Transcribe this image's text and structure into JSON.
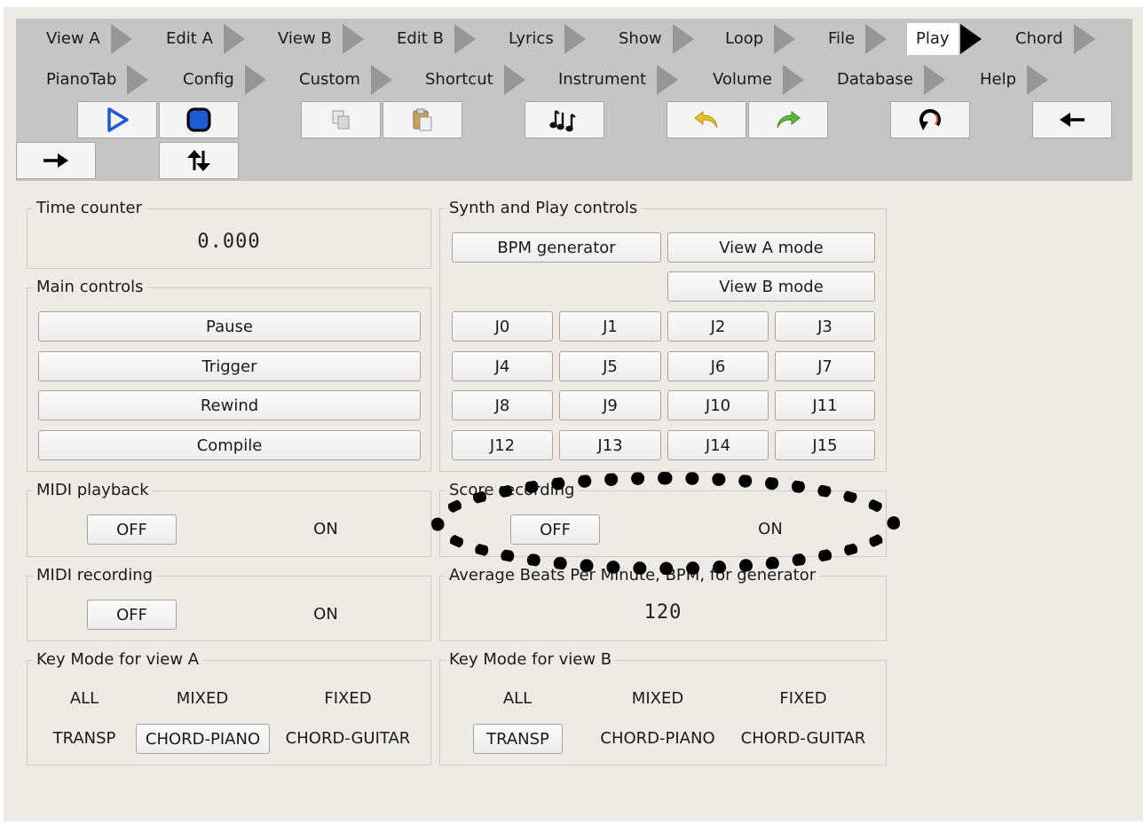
{
  "menu": {
    "row1": [
      {
        "label": "View A"
      },
      {
        "label": "Edit A"
      },
      {
        "label": "View B"
      },
      {
        "label": "Edit B"
      },
      {
        "label": "Lyrics"
      },
      {
        "label": "Show"
      },
      {
        "label": "Loop"
      },
      {
        "label": "File"
      },
      {
        "label": "Play",
        "active": true
      },
      {
        "label": "Chord"
      }
    ],
    "row2": [
      {
        "label": "PianoTab"
      },
      {
        "label": "Config"
      },
      {
        "label": "Custom"
      },
      {
        "label": "Shortcut"
      },
      {
        "label": "Instrument"
      },
      {
        "label": "Volume"
      },
      {
        "label": "Database"
      },
      {
        "label": "Help"
      }
    ]
  },
  "toolbar": {
    "icons": [
      "play-icon",
      "stop-icon",
      "copy-icon",
      "paste-icon",
      "music-notes-icon",
      "undo-icon",
      "redo-icon",
      "refresh-icon",
      "arrow-left-icon",
      "arrow-right-icon",
      "swap-vertical-icon"
    ]
  },
  "time_counter": {
    "title": "Time counter",
    "value": "0.000"
  },
  "main_controls": {
    "title": "Main controls",
    "pause": "Pause",
    "trigger": "Trigger",
    "rewind": "Rewind",
    "compile": "Compile"
  },
  "synth": {
    "title": "Synth and Play controls",
    "bpm_generator": "BPM generator",
    "view_a_mode": "View A mode",
    "view_b_mode": "View B mode",
    "jumps": [
      "J0",
      "J1",
      "J2",
      "J3",
      "J4",
      "J5",
      "J6",
      "J7",
      "J8",
      "J9",
      "J10",
      "J11",
      "J12",
      "J13",
      "J14",
      "J15"
    ]
  },
  "midi_playback": {
    "title": "MIDI playback",
    "off": "OFF",
    "on": "ON",
    "selected": "OFF"
  },
  "score_recording": {
    "title": "Score recording",
    "off": "OFF",
    "on": "ON",
    "selected": "OFF"
  },
  "midi_recording": {
    "title": "MIDI recording",
    "off": "OFF",
    "on": "ON",
    "selected": "OFF"
  },
  "avg_bpm": {
    "title": "Average Beats Per Minute, BPM, for generator",
    "value": "120"
  },
  "key_mode_a": {
    "title": "Key Mode for view A",
    "all": "ALL",
    "mixed": "MIXED",
    "fixed": "FIXED",
    "transp": "TRANSP",
    "chord_piano": "CHORD-PIANO",
    "chord_guitar": "CHORD-GUITAR",
    "selected": "CHORD-PIANO"
  },
  "key_mode_b": {
    "title": "Key Mode for view B",
    "all": "ALL",
    "mixed": "MIXED",
    "fixed": "FIXED",
    "transp": "TRANSP",
    "chord_piano": "CHORD-PIANO",
    "chord_guitar": "CHORD-GUITAR",
    "selected": "TRANSP"
  },
  "colors": {
    "toolbar_bg": "#c5c5c5",
    "window_bg": "#eeebe7",
    "play_blue": "#1e5ad6",
    "undo_yellow": "#e8c02a",
    "redo_green": "#5fb83c"
  }
}
